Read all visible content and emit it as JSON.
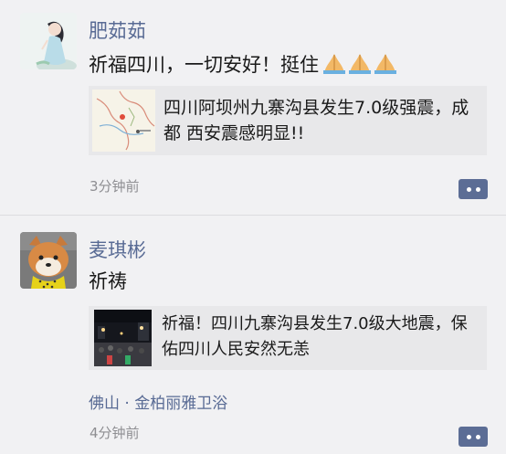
{
  "posts": [
    {
      "author": "肥茹茹",
      "text": "祈福四川，一切安好！挺住",
      "emoji_icons": [
        "folded-hands-icon",
        "folded-hands-icon",
        "folded-hands-icon"
      ],
      "link": {
        "title": "四川阿坝州九寨沟县发生7.0级强震，成都 西安震感明显!!",
        "thumb_icon": "map-thumbnail"
      },
      "time": "3分钟前"
    },
    {
      "author": "麦琪彬",
      "text": "祈祷",
      "link": {
        "title": "祈福！四川九寨沟县发生7.0级大地震，保佑四川人民安然无恙",
        "thumb_icon": "night-street-thumbnail"
      },
      "location": "佛山 · 金柏丽雅卫浴",
      "time": "4分钟前"
    }
  ],
  "colors": {
    "name": "#586a94",
    "background": "#f1f1f3",
    "card": "#e8e8ea",
    "button": "#5c6d95"
  }
}
